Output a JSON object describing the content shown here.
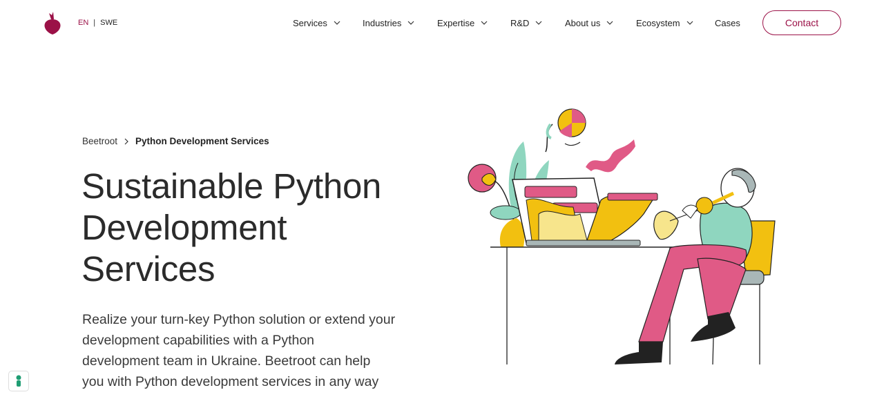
{
  "header": {
    "lang_active": "EN",
    "lang_separator": "|",
    "lang_other": "SWE",
    "nav": [
      {
        "label": "Services"
      },
      {
        "label": "Industries"
      },
      {
        "label": "Expertise"
      },
      {
        "label": "R&D"
      },
      {
        "label": "About us"
      },
      {
        "label": "Ecosystem"
      },
      {
        "label": "Cases"
      }
    ],
    "contact_label": "Contact"
  },
  "breadcrumb": {
    "root": "Beetroot",
    "current": "Python Development Services"
  },
  "hero": {
    "title_line1": "Sustainable Python",
    "title_line2": "Development",
    "title_line3": "Services",
    "lead_line1": "Realize your turn-key Python solution or extend your",
    "lead_line2": "development capabilities with a Python",
    "lead_line3": "development team in Ukraine. Beetroot can help",
    "lead_line4": "you with Python development services in any way"
  },
  "colors": {
    "brand": "#9b1147",
    "pink": "#e05a86",
    "yellow": "#f2c010",
    "mint": "#8fd6bf",
    "gray": "#a9b7b7"
  },
  "icons": {
    "logo": "beetroot-logo-icon",
    "chevron": "chevron-down-icon",
    "breadcrumb_sep": "chevron-right-icon",
    "cookie": "cookie-consent-icon"
  }
}
